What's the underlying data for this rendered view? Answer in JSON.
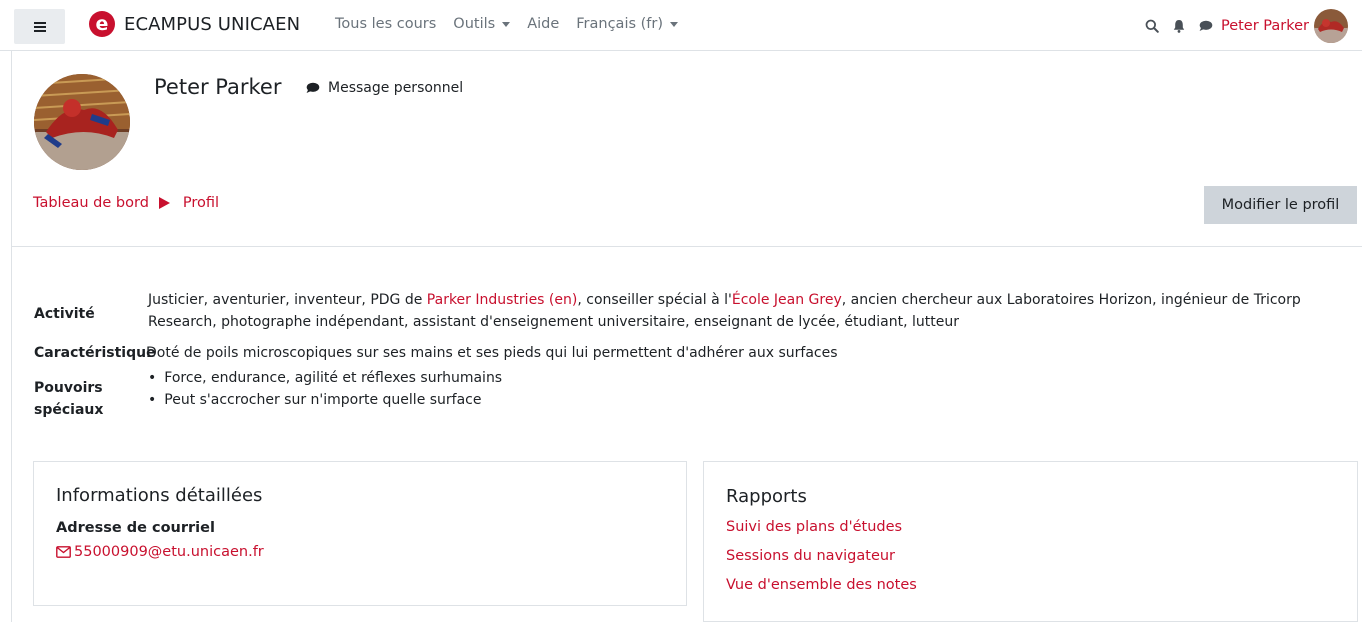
{
  "navbar": {
    "brand_logo_letter": "e",
    "brand_name": "ECAMPUS UNICAEN",
    "links": [
      {
        "label": "Tous les cours",
        "dropdown": false
      },
      {
        "label": "Outils",
        "dropdown": true
      },
      {
        "label": "Aide",
        "dropdown": false
      },
      {
        "label": "Français (fr)",
        "dropdown": true
      }
    ],
    "icons": [
      "search-icon",
      "bell-icon",
      "chat-icon"
    ],
    "user_name": "Peter Parker"
  },
  "header": {
    "name": "Peter Parker",
    "message_label": "Message personnel",
    "breadcrumb": [
      "Tableau de bord",
      "Profil"
    ],
    "edit_button": "Modifier le profil"
  },
  "fields": {
    "activite": {
      "label": "Activité",
      "parts": [
        "Justicier, aventurier, inventeur, PDG de ",
        "Parker Industries (en)",
        ", conseiller spécial à l'",
        "École Jean Grey",
        ", ancien chercheur aux Laboratoires Horizon, ingénieur de Tricorp",
        "Research, photographe indépendant, assistant d'enseignement universitaire, enseignant de lycée, étudiant, lutteur"
      ]
    },
    "caracteristique": {
      "label": "Caractéristique",
      "value": "Doté de poils microscopiques sur ses mains et ses pieds qui lui permettent d'adhérer aux surfaces"
    },
    "pouvoirs": {
      "label_line1": "Pouvoirs",
      "label_line2": "spéciaux",
      "items": [
        "Force, endurance, agilité et réflexes surhumains",
        "Peut s'accrocher sur n'importe quelle surface"
      ]
    }
  },
  "details_card": {
    "title": "Informations détaillées",
    "email_label": "Adresse de courriel",
    "email": "55000909@etu.unicaen.fr"
  },
  "reports_card": {
    "title": "Rapports",
    "links": [
      "Suivi des plans d'études",
      "Sessions du navigateur",
      "Vue d'ensemble des notes"
    ]
  },
  "colors": {
    "accent": "#c8102e",
    "button_bg": "#ced4da",
    "text": "#1d2125",
    "muted": "#6a737b"
  }
}
